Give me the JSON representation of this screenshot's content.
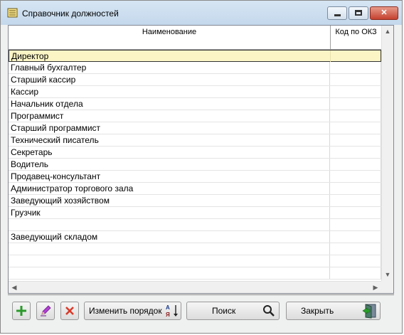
{
  "window": {
    "title": "Справочник должностей",
    "minimize_glyph": "",
    "maximize_glyph": "",
    "close_glyph": "✕"
  },
  "grid": {
    "columns": [
      "Наименование",
      "Код по ОКЗ"
    ],
    "rows": [
      {
        "name": "Директор",
        "code": "",
        "selected": true
      },
      {
        "name": "Главный бухгалтер",
        "code": ""
      },
      {
        "name": "Старший кассир",
        "code": ""
      },
      {
        "name": "Кассир",
        "code": ""
      },
      {
        "name": "Начальник отдела",
        "code": ""
      },
      {
        "name": "Программист",
        "code": ""
      },
      {
        "name": "Старший программист",
        "code": ""
      },
      {
        "name": "Технический писатель",
        "code": ""
      },
      {
        "name": "Секретарь",
        "code": ""
      },
      {
        "name": "Водитель",
        "code": ""
      },
      {
        "name": "Продавец-консультант",
        "code": ""
      },
      {
        "name": "Администратор торгового зала",
        "code": ""
      },
      {
        "name": "Заведующий хозяйством",
        "code": ""
      },
      {
        "name": "Грузчик",
        "code": ""
      },
      {
        "name": "",
        "code": ""
      },
      {
        "name": "Заведующий складом",
        "code": ""
      },
      {
        "name": "",
        "code": ""
      },
      {
        "name": "",
        "code": ""
      },
      {
        "name": "",
        "code": ""
      }
    ]
  },
  "toolbar": {
    "add_icon": "plus-icon",
    "edit_icon": "pencil-icon",
    "delete_icon": "x-icon",
    "order_label": "Изменить порядок",
    "search_label": "Поиск",
    "close_label": "Закрыть"
  },
  "colors": {
    "selected_row": "#fbf5c6",
    "add_green": "#2a9a2a",
    "delete_red": "#d93a2a",
    "edit_purple": "#a030c0"
  }
}
